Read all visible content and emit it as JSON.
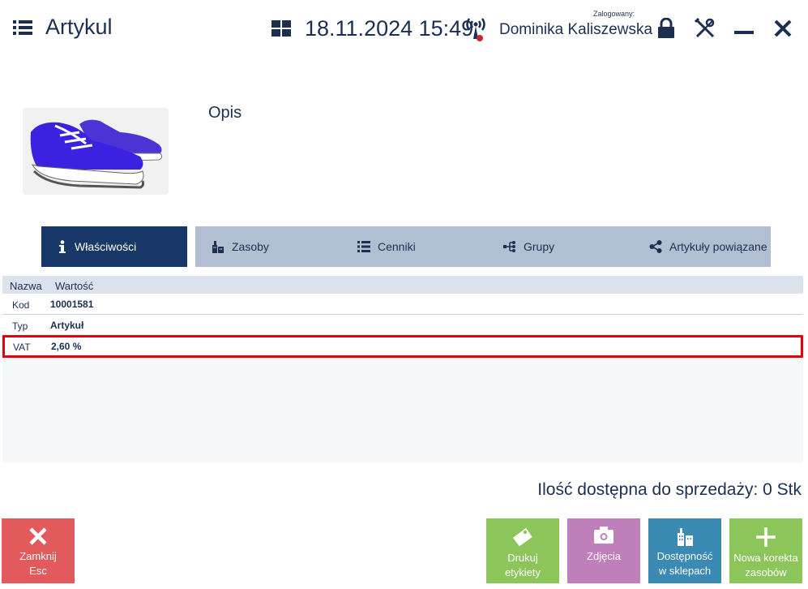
{
  "header": {
    "title": "Artykul",
    "datetime": "18.11.2024 15:49",
    "logged_caption": "Zalogowany:",
    "user_name": "Dominika Kaliszewska"
  },
  "article": {
    "description_label": "Opis"
  },
  "tabs": [
    {
      "label": "Właściwości",
      "icon": "info-icon",
      "active": true
    },
    {
      "label": "Zasoby",
      "icon": "warehouse-icon",
      "active": false
    },
    {
      "label": "Cenniki",
      "icon": "list-icon",
      "active": false
    },
    {
      "label": "Grupy",
      "icon": "tree-icon",
      "active": false
    },
    {
      "label": "Artykuły powiązane",
      "icon": "share-icon",
      "active": false
    }
  ],
  "grid": {
    "columns": [
      "Nazwa",
      "Wartość"
    ],
    "rows": [
      {
        "name": "Kod",
        "value": "10001581"
      },
      {
        "name": "Typ",
        "value": "Artykuł"
      },
      {
        "name": "VAT",
        "value": "2,60 %"
      }
    ]
  },
  "quantity": {
    "label": "Ilość dostępna do sprzedaży:",
    "value": "0 Stk"
  },
  "buttons": {
    "close_line1": "Zamknij",
    "close_line2": "Esc",
    "print_line1": "Drukuj",
    "print_line2": "etykiety",
    "photos": "Zdjęcia",
    "avail_line1": "Dostępność",
    "avail_line2": "w sklepach",
    "new_line1": "Nowa korekta",
    "new_line2": "zasobów"
  },
  "colors": {
    "primary": "#173869",
    "tab_inactive": "#b2bfd3",
    "close": "#e25a5c",
    "green": "#8cc65b",
    "purple": "#bf7fba",
    "blue": "#3b8ab4",
    "highlight": "#e3000f"
  }
}
